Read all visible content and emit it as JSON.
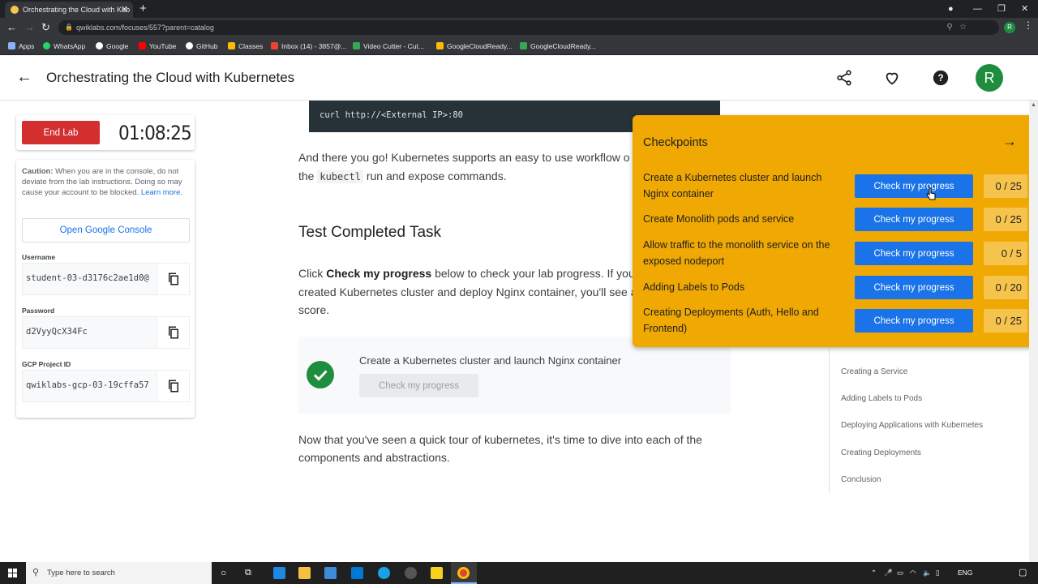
{
  "browser": {
    "tab_title": "Orchestrating the Cloud with Kub",
    "url": "qwiklabs.com/focuses/557?parent=catalog",
    "bookmarks": [
      {
        "label": "Apps",
        "color": "#8ab4f8"
      },
      {
        "label": "WhatsApp",
        "color": "#25d366"
      },
      {
        "label": "Google",
        "color": "#ffffff"
      },
      {
        "label": "YouTube",
        "color": "#ff0000"
      },
      {
        "label": "GitHub",
        "color": "#ffffff"
      },
      {
        "label": "Classes",
        "color": "#fbbc04"
      },
      {
        "label": "Inbox (14) - 3857@...",
        "color": "#ea4335"
      },
      {
        "label": "Video Cutter - Cut...",
        "color": "#34a853"
      },
      {
        "label": "GoogleCloudReady...",
        "color": "#fbbc04"
      },
      {
        "label": "GoogleCloudReady...",
        "color": "#34a853"
      }
    ],
    "profile_initial": "R"
  },
  "header": {
    "title": "Orchestrating the Cloud with Kubernetes",
    "avatar_initial": "R"
  },
  "lab": {
    "end_lab_label": "End Lab",
    "timer": "01:08:25",
    "caution_bold": "Caution:",
    "caution_text": " When you are in the console, do not deviate from the lab instructions. Doing so may cause your account to be blocked.",
    "learn_more": "Learn more.",
    "open_console_label": "Open Google Console",
    "username_label": "Username",
    "username_value": "student-03-d3176c2ae1d0@",
    "password_label": "Password",
    "password_value": "d2VyyQcX34Fc",
    "project_label": "GCP Project ID",
    "project_value": "qwiklabs-gcp-03-19cffa57"
  },
  "content": {
    "code": "curl http://<External IP>:80",
    "p1_a": "And there you go! Kubernetes supports an easy to use workflow o",
    "p1_b_pre": "the ",
    "p1_b_code": "kubectl",
    "p1_b_post": " run and expose commands.",
    "heading": "Test Completed Task",
    "p2_a_pre": "Click ",
    "p2_a_bold": "Check my progress",
    "p2_a_post": " below to check your lab progress. If you",
    "p2_b": "created Kubernetes cluster and deploy Nginx container, you'll see a",
    "p2_c": "score.",
    "task_name": "Create a Kubernetes cluster and launch Nginx container",
    "task_button": "Check my progress",
    "p3_a": "Now that you've seen a quick tour of kubernetes, it's time to dive into each of the",
    "p3_b": "components and abstractions."
  },
  "toc": [
    "Creating a Service",
    "Adding Labels to Pods",
    "Deploying Applications with Kubernetes",
    "Creating Deployments",
    "Conclusion"
  ],
  "checkpoints": {
    "title": "Checkpoints",
    "button_label": "Check my progress",
    "items": [
      {
        "label": "Create a Kubernetes cluster and launch Nginx container",
        "score": "0 / 25"
      },
      {
        "label": "Create Monolith pods and service",
        "score": "0 / 25"
      },
      {
        "label": "Allow traffic to the monolith service on the exposed nodeport",
        "score": "0 / 5"
      },
      {
        "label": "Adding Labels to Pods",
        "score": "0 / 20"
      },
      {
        "label": "Creating Deployments (Auth, Hello and Frontend)",
        "score": "0 / 25"
      }
    ]
  },
  "taskbar": {
    "search_placeholder": "Type here to search",
    "lang": "ENG"
  }
}
